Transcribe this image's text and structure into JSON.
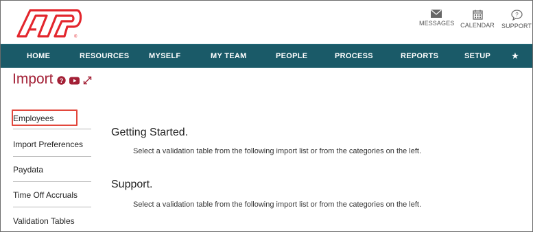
{
  "header": {
    "buttons": [
      {
        "label": "MESSAGES",
        "icon": "envelope-icon"
      },
      {
        "label": "CALENDAR",
        "icon": "calendar-icon"
      },
      {
        "label": "SUPPORT",
        "icon": "chat-question-icon"
      }
    ],
    "logo_color": "#e3262d"
  },
  "nav": {
    "items": [
      "HOME",
      "RESOURCES",
      "MYSELF",
      "MY TEAM",
      "PEOPLE",
      "PROCESS",
      "REPORTS",
      "SETUP"
    ],
    "favorites_icon": "star-icon",
    "background": "#1a5a68"
  },
  "page": {
    "title": "Import",
    "title_icons": [
      "help-icon",
      "video-icon",
      "expand-icon"
    ],
    "title_color": "#a32036"
  },
  "sidebar": {
    "items": [
      {
        "label": "Employees",
        "active": true
      },
      {
        "label": "Import Preferences"
      },
      {
        "label": "Paydata"
      },
      {
        "label": "Time Off Accruals"
      },
      {
        "label": "Validation Tables"
      }
    ]
  },
  "content": {
    "sections": [
      {
        "title": "Getting Started.",
        "description": "Select a validation table from the following import list or from the categories on the left."
      },
      {
        "title": "Support.",
        "description": "Select a validation table from the following import list or from the categories on the left."
      }
    ]
  }
}
